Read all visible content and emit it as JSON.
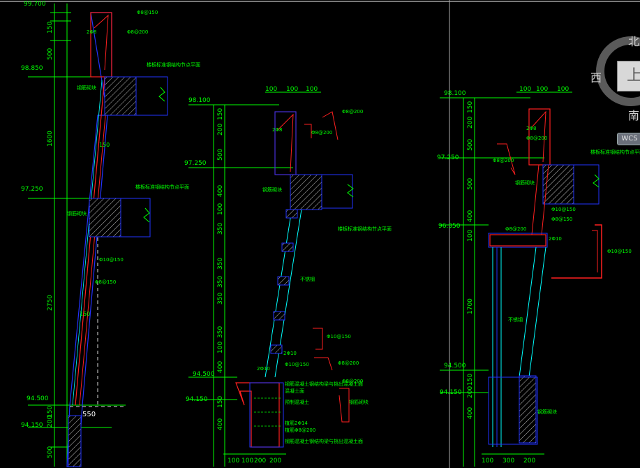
{
  "viewcube": {
    "north": "北",
    "west": "西",
    "south": "南",
    "face": "上",
    "wcs_label": "WCS"
  },
  "section_a": {
    "top_elevation": "99.700",
    "elevations": [
      "98.850",
      "97.250",
      "94.500",
      "94.150"
    ],
    "dimensions_vertical": [
      "150",
      "200",
      "500",
      "1600",
      "2750",
      "200",
      "150",
      "500"
    ],
    "labels": [
      "楼板标准钢结构节点平面",
      "钢筋砌块",
      "楼板标准钢结构节点平面",
      "钢筋砌块",
      "Φ8@150",
      "Φ8@200",
      "Φ10@150",
      "Φ8@150"
    ],
    "dim_150a": "150",
    "dim_150b": "150",
    "dim_550": "550",
    "tag_248": "2Φ8"
  },
  "section_b": {
    "elevations": [
      "98.100",
      "97.250",
      "94.500",
      "94.150"
    ],
    "top_dims": [
      "100",
      "100",
      "100"
    ],
    "bottom_dims": [
      "100",
      "100",
      "200",
      "200"
    ],
    "dimensions_vertical": [
      "150",
      "200",
      "500",
      "400",
      "100",
      "350",
      "350",
      "350",
      "350",
      "350",
      "100",
      "400",
      "150",
      "400"
    ],
    "notes": [
      "Φ8@200",
      "Φ8@200",
      "钢筋砌块",
      "楼板标准钢结构节点平面",
      "不锈钢",
      "Φ10@150",
      "2Φ10",
      "Φ10@150",
      "Φ8@200",
      "Φ8@200",
      "钢筋砌块",
      "预制混凝土",
      "钢筋混凝土钢结构梁与挑出混凝土面",
      "混凝土面",
      "植筋2Φ14",
      "植筋Φ8@200",
      "钢筋混凝土钢结构梁与挑出混凝土面",
      "2Φ10",
      "2Φ8"
    ]
  },
  "section_c": {
    "elevations": [
      "98.100",
      "97.250",
      "96.350",
      "94.500",
      "94.150"
    ],
    "top_dims": [
      "100",
      "100",
      "100"
    ],
    "bottom_dims": [
      "100",
      "300",
      "200"
    ],
    "dimensions_vertical": [
      "150",
      "200",
      "500",
      "500",
      "400",
      "100",
      "1700",
      "150",
      "200",
      "400"
    ],
    "notes": [
      "楼板标准钢结构节点平面",
      "Φ8@200",
      "Φ8@200",
      "钢筋砌块",
      "Φ10@150",
      "Φ8@150",
      "Φ8@200",
      "Φ10@150",
      "钢筋砌块",
      "不锈钢",
      "2Φ10",
      "2Φ8"
    ]
  }
}
